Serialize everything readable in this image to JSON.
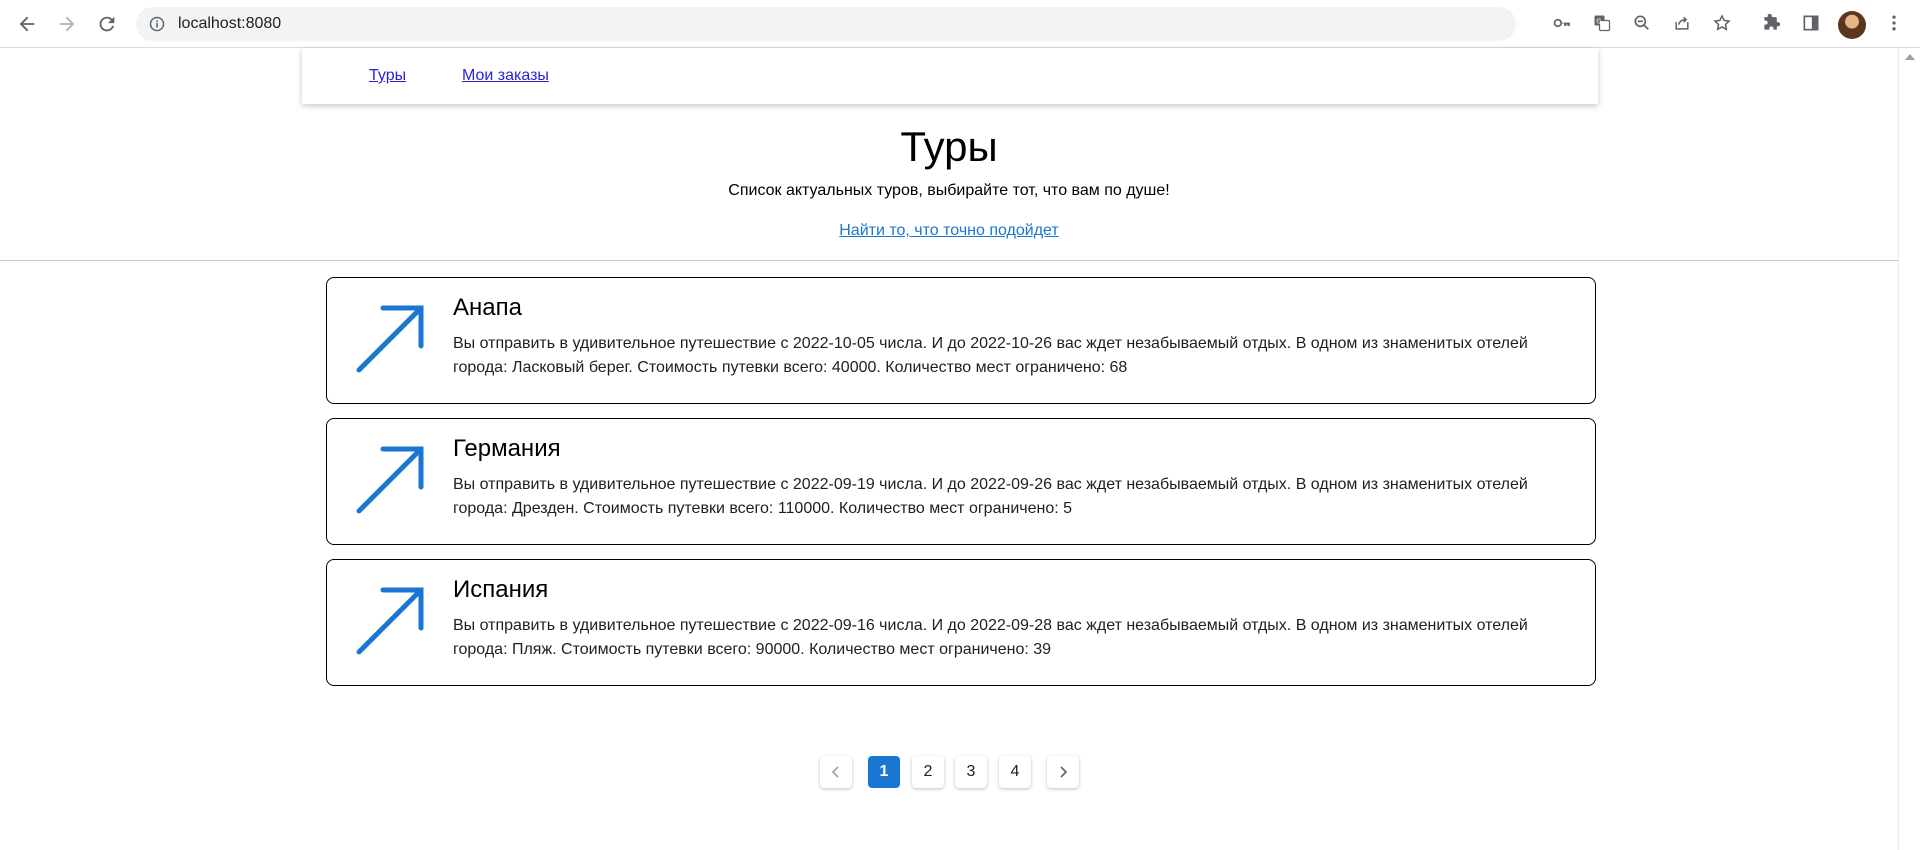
{
  "browser": {
    "url": "localhost:8080"
  },
  "nav": {
    "tours_label": "Туры",
    "orders_label": "Мои заказы"
  },
  "header": {
    "title": "Туры",
    "subtitle": "Список актуальных туров, выбирайте тот, что вам по душе!",
    "find_link": "Найти то, что точно подойдет"
  },
  "tours": [
    {
      "title": "Анапа",
      "description": "Вы отправить в удивительное путешествие с 2022-10-05 числа. И до 2022-10-26 вас ждет незабываемый отдых. В одном из знаменитых отелей города: Ласковый берег. Стоимость путевки всего: 40000. Количество мест ограничено: 68"
    },
    {
      "title": "Германия",
      "description": "Вы отправить в удивительное путешествие с 2022-09-19 числа. И до 2022-09-26 вас ждет незабываемый отдых. В одном из знаменитых отелей города: Дрезден. Стоимость путевки всего: 110000. Количество мест ограничено: 5"
    },
    {
      "title": "Испания",
      "description": "Вы отправить в удивительное путешествие с 2022-09-16 числа. И до 2022-09-28 вас ждет незабываемый отдых. В одном из знаменитых отелей города: Пляж. Стоимость путевки всего: 90000. Количество мест ограничено: 39"
    }
  ],
  "pagination": {
    "pages": [
      "1",
      "2",
      "3",
      "4"
    ],
    "current": "1"
  },
  "colors": {
    "accent": "#1976d2",
    "icon_arrow": "#1976d2",
    "nav_link": "#2a1fd6"
  },
  "icons": {
    "card_icon": "north-east-arrow-icon",
    "prev": "chevron-left-icon",
    "next": "chevron-right-icon"
  }
}
